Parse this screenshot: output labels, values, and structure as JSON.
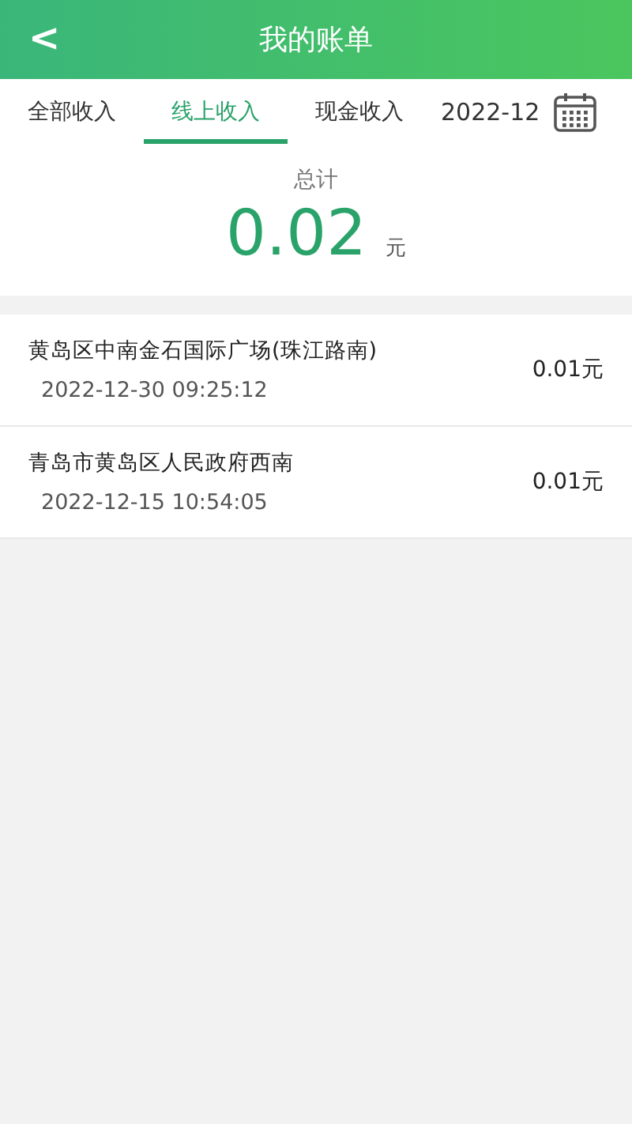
{
  "header": {
    "back": "<",
    "title": "我的账单"
  },
  "tabs": [
    {
      "label": "全部收入",
      "selected": false
    },
    {
      "label": "线上收入",
      "selected": true
    },
    {
      "label": "现金收入",
      "selected": false
    }
  ],
  "month": "2022-12",
  "total": {
    "label": "总计",
    "amount": "0.02",
    "unit": "元"
  },
  "records": [
    {
      "place": "黄岛区中南金石国际广场(珠江路南)",
      "time": "2022-12-30 09:25:12",
      "amount": "0.01元"
    },
    {
      "place": "青岛市黄岛区人民政府西南",
      "time": "2022-12-15 10:54:05",
      "amount": "0.01元"
    }
  ]
}
